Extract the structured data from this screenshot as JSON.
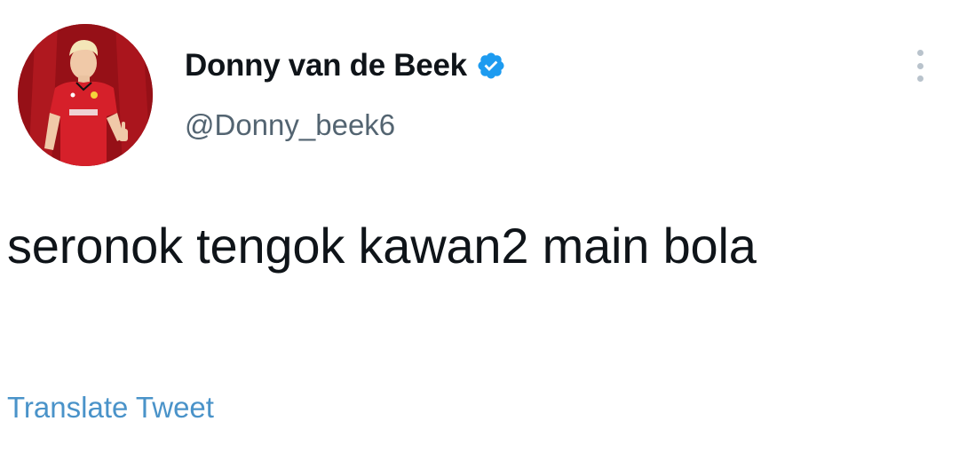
{
  "tweet": {
    "author": {
      "display_name": "Donny van de Beek",
      "handle": "@Donny_beek6",
      "verified": true,
      "verified_icon": "verified-badge-icon",
      "avatar_icon": "profile-photo"
    },
    "text": "seronok tengok kawan2 main bola",
    "translate_label": "Translate Tweet",
    "more_icon": "more-options-icon"
  },
  "colors": {
    "text": "#0f1419",
    "secondary_text": "#536471",
    "link": "#4a93c9",
    "verified": "#1d9bf0",
    "avatar_background": "#a3121a"
  }
}
